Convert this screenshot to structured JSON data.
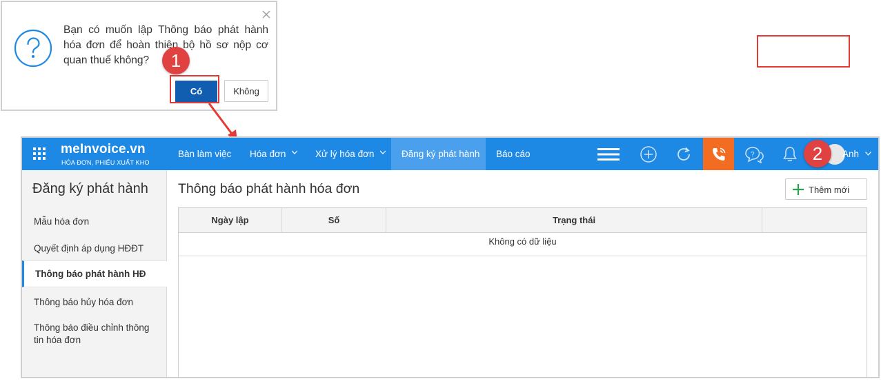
{
  "dialog": {
    "message": "Bạn có muốn lập Thông báo phát hành hóa đơn để hoàn thiện bộ hồ sơ nộp cơ quan thuế không?",
    "yes_label": "Có",
    "no_label": "Không",
    "close_icon": "close-icon",
    "question_icon": "question-circle-icon"
  },
  "annotations": {
    "step1": "1",
    "step2": "2",
    "highlight_color": "#e53935"
  },
  "app": {
    "logo": "meInvoice.vn",
    "logo_sub": "HÓA ĐƠN, PHIẾU XUẤT KHO",
    "nav": {
      "desk": "Bàn làm việc",
      "invoice": "Hóa đơn",
      "process": "Xử lý hóa đơn",
      "register": "Đăng ký phát hành",
      "report": "Báo cáo"
    },
    "user": "Anh",
    "colors": {
      "topbar": "#1e88e5",
      "active_nav": "#4aa0ec",
      "phone": "#f26d21",
      "primary_button": "#115eb1"
    }
  },
  "sidebar": {
    "title": "Đăng ký phát hành",
    "items": [
      "Mẫu hóa đơn",
      "Quyết định áp dụng HĐĐT",
      "Thông báo phát hành HĐ",
      "Thông báo hủy hóa đơn",
      "Thông báo điều chỉnh thông tin hóa đơn"
    ],
    "active_index": 2
  },
  "main": {
    "title": "Thông báo phát hành hóa đơn",
    "add_label": "Thêm mới",
    "columns": [
      "Ngày lập",
      "Số",
      "Trạng thái",
      ""
    ],
    "empty_text": "Không có dữ liệu"
  }
}
